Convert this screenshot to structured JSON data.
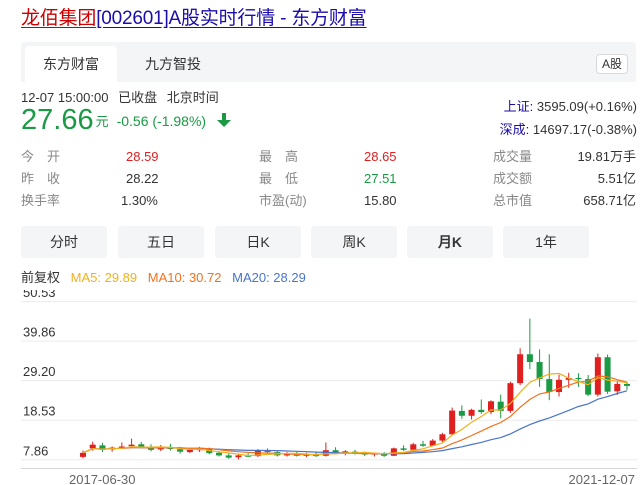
{
  "page": {
    "title_highlight": "龙佰集团",
    "title_rest": "[002601]A股实时行情 - 东方财富"
  },
  "source_tabs": [
    {
      "label": "东方财富",
      "active": true
    },
    {
      "label": "九方智投",
      "active": false
    }
  ],
  "market_badge": "A股",
  "status": {
    "datetime": "12-07 15:00:00",
    "state": "已收盘",
    "timezone": "北京时间"
  },
  "quote": {
    "price": "27.66",
    "unit": "元",
    "change": "-0.56 (-1.98%)",
    "direction": "down",
    "color": "#1a9a44"
  },
  "indices": [
    {
      "name": "上证:",
      "value": "3595.09(+0.16%)"
    },
    {
      "name": "深成:",
      "value": "14697.17(-0.38%)"
    }
  ],
  "stats": {
    "open_label": "今　开",
    "open": "28.59",
    "prev_close_label": "昨　收",
    "prev_close": "28.22",
    "turnover_rate_label": "换手率",
    "turnover_rate": "1.30%",
    "high_label": "最　高",
    "high": "28.65",
    "low_label": "最　低",
    "low": "27.51",
    "pe_label": "市盈(动)",
    "pe": "15.80",
    "volume_label": "成交量",
    "volume": "19.81万手",
    "amount_label": "成交额",
    "amount": "5.51亿",
    "market_cap_label": "总市值",
    "market_cap": "658.71亿"
  },
  "period_tabs": [
    {
      "label": "分时",
      "active": false
    },
    {
      "label": "五日",
      "active": false
    },
    {
      "label": "日K",
      "active": false
    },
    {
      "label": "周K",
      "active": false
    },
    {
      "label": "月K",
      "active": true
    },
    {
      "label": "1年",
      "active": false
    }
  ],
  "ma_legend": {
    "adjust": "前复权",
    "ma5": "MA5: 29.89",
    "ma10": "MA10: 30.72",
    "ma20": "MA20: 28.29"
  },
  "colors": {
    "up": "#e02020",
    "down": "#1a9a44",
    "ma5": "#f2b01e",
    "ma10": "#f2711c",
    "ma20": "#4a75c9",
    "link": "#1a0dab"
  },
  "chart_data": {
    "type": "candlestick",
    "period": "monthly",
    "y_ticks": [
      "50.53",
      "39.86",
      "29.20",
      "18.53",
      "7.86"
    ],
    "ylim": [
      5.5,
      53
    ],
    "x_labels": [
      "2017-06-30",
      "2021-12-07"
    ],
    "grid": true,
    "candles": [
      [
        8.5,
        10.2,
        8.1,
        9.6
      ],
      [
        10.8,
        12.6,
        10.2,
        11.8
      ],
      [
        11.6,
        12.3,
        9.8,
        10.4
      ],
      [
        10.5,
        11.3,
        9.9,
        11.0
      ],
      [
        11.0,
        12.4,
        10.6,
        11.3
      ],
      [
        11.4,
        13.4,
        10.9,
        11.8
      ],
      [
        11.9,
        12.5,
        10.8,
        11.2
      ],
      [
        11.2,
        11.9,
        10.0,
        10.4
      ],
      [
        10.5,
        11.7,
        10.1,
        11.3
      ],
      [
        11.2,
        12.0,
        10.2,
        10.6
      ],
      [
        10.6,
        11.2,
        9.4,
        9.9
      ],
      [
        9.8,
        10.7,
        9.5,
        10.4
      ],
      [
        10.3,
        11.2,
        9.8,
        10.7
      ],
      [
        10.6,
        11.0,
        9.2,
        9.5
      ],
      [
        9.6,
        10.0,
        8.6,
        8.9
      ],
      [
        8.9,
        9.4,
        8.0,
        8.3
      ],
      [
        8.4,
        9.2,
        7.8,
        8.9
      ],
      [
        8.8,
        9.5,
        8.4,
        8.7
      ],
      [
        8.7,
        10.6,
        8.5,
        10.2
      ],
      [
        10.2,
        10.8,
        9.5,
        9.8
      ],
      [
        9.8,
        10.2,
        8.6,
        8.9
      ],
      [
        8.9,
        9.8,
        8.6,
        9.5
      ],
      [
        9.5,
        9.9,
        8.6,
        8.8
      ],
      [
        8.8,
        9.6,
        8.4,
        9.3
      ],
      [
        9.3,
        9.8,
        8.5,
        8.7
      ],
      [
        8.8,
        12.4,
        8.6,
        10.3
      ],
      [
        10.3,
        11.1,
        9.4,
        9.6
      ],
      [
        9.6,
        10.3,
        8.9,
        10.0
      ],
      [
        9.9,
        10.4,
        9.1,
        9.4
      ],
      [
        9.4,
        9.9,
        8.7,
        9.2
      ],
      [
        9.2,
        9.7,
        8.6,
        9.4
      ],
      [
        9.4,
        9.8,
        8.5,
        8.8
      ],
      [
        8.8,
        11.0,
        8.7,
        10.8
      ],
      [
        10.8,
        11.6,
        10.1,
        10.4
      ],
      [
        10.4,
        12.3,
        10.2,
        11.9
      ],
      [
        11.9,
        12.8,
        11.2,
        11.5
      ],
      [
        11.5,
        13.3,
        11.3,
        12.9
      ],
      [
        12.9,
        15.0,
        12.5,
        14.6
      ],
      [
        14.6,
        21.8,
        14.3,
        21.0
      ],
      [
        20.9,
        22.4,
        18.8,
        19.6
      ],
      [
        19.6,
        21.5,
        18.6,
        21.2
      ],
      [
        21.2,
        24.0,
        20.1,
        20.6
      ],
      [
        20.6,
        23.8,
        20.0,
        23.5
      ],
      [
        23.4,
        25.3,
        18.9,
        20.9
      ],
      [
        20.9,
        28.8,
        20.4,
        28.4
      ],
      [
        28.4,
        37.8,
        27.9,
        36.2
      ],
      [
        36.2,
        45.8,
        32.2,
        34.1
      ],
      [
        34.1,
        37.5,
        27.4,
        29.5
      ],
      [
        29.5,
        36.2,
        23.8,
        26.0
      ],
      [
        26.0,
        30.7,
        24.8,
        29.3
      ],
      [
        29.3,
        31.2,
        27.1,
        29.8
      ],
      [
        29.8,
        31.1,
        27.4,
        29.5
      ],
      [
        29.5,
        30.6,
        24.9,
        25.3
      ],
      [
        25.3,
        36.4,
        24.8,
        35.4
      ],
      [
        35.4,
        36.1,
        25.5,
        26.1
      ],
      [
        26.2,
        29.1,
        25.2,
        28.2
      ],
      [
        28.2,
        28.7,
        26.6,
        27.66
      ]
    ]
  }
}
